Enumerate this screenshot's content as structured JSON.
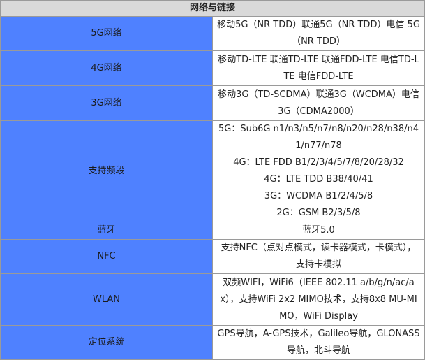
{
  "header": {
    "title": "网络与链接"
  },
  "rows": [
    {
      "label": "5G网络",
      "value_lines": [
        "移动5G（NR TDD）联通5G（NR TDD）电信 5G（NR TDD）"
      ]
    },
    {
      "label": "4G网络",
      "value_lines": [
        "移动TD-LTE 联通TD-LTE 联通FDD-LTE 电信TD-LTE 电信FDD-LTE"
      ]
    },
    {
      "label": "3G网络",
      "value_lines": [
        "移动3G（TD-SCDMA）联通3G（WCDMA）电信3G（CDMA2000）"
      ]
    },
    {
      "label": "支持频段",
      "value_lines": [
        "5G：Sub6G n1/n3/n5/n7/n8/n20/n28/n38/n41/n77/n78",
        "4G：LTE FDD B1/2/3/4/5/7/8/20/28/32",
        "4G：LTE TDD B38/40/41",
        "3G：WCDMA B1/2/4/5/8",
        "2G：GSM B2/3/5/8"
      ]
    },
    {
      "label": "蓝牙",
      "value_lines": [
        "蓝牙5.0"
      ]
    },
    {
      "label": "NFC",
      "value_lines": [
        "支持NFC（点对点模式，读卡器模式，卡模式），支持卡模拟"
      ]
    },
    {
      "label": "WLAN",
      "value_lines": [
        "双频WIFI，WiFi6（IEEE 802.11 a/b/g/n/ac/ax），支持WiFi 2x2 MIMO技术，支持8x8 MU-MIMO，WiFi Display"
      ]
    },
    {
      "label": "定位系统",
      "value_lines": [
        "GPS导航，A-GPS技术，Galileo导航，GLONASS导航，北斗导航"
      ]
    }
  ],
  "colors": {
    "label_bg": "#4f81ff",
    "header_bg": "#d9d9d9",
    "border": "#9a9a9a"
  }
}
